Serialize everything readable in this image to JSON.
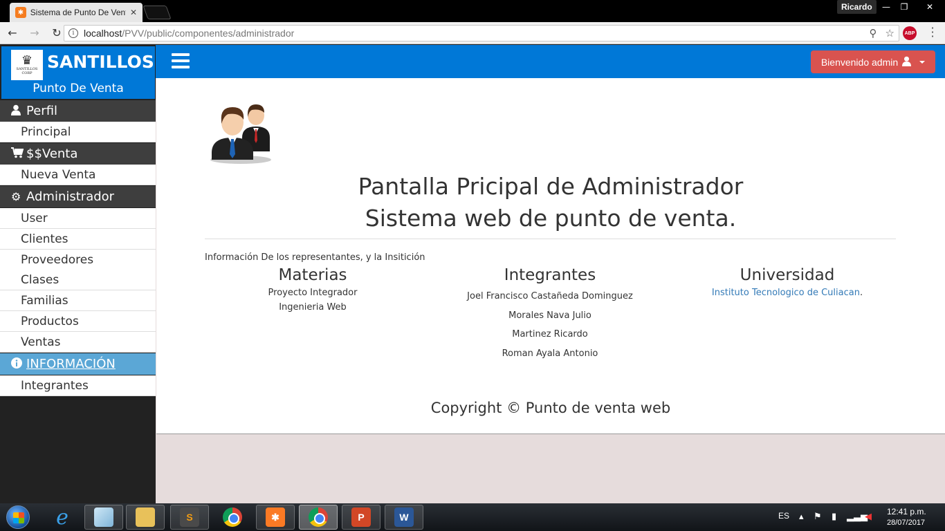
{
  "browser": {
    "tab_title": "Sistema de Punto De Venta",
    "tab_close": "✕",
    "user_badge": "Ricardo",
    "url_host": "localhost",
    "url_path": "/PVV/public/componentes/administrador",
    "abp_label": "ABP"
  },
  "sidebar": {
    "brand_title": "SANTILLOS",
    "brand_subtitle": "Punto De Venta",
    "logo_text": "SANTILLOS",
    "logo_subtext": "CORP",
    "sections": [
      {
        "icon": "user-icon",
        "label": "Perfil",
        "items": [
          "Principal"
        ]
      },
      {
        "icon": "cart-icon",
        "label": "$$Venta",
        "items": [
          "Nueva Venta"
        ]
      },
      {
        "icon": "cogs-icon",
        "label": "Administrador",
        "items": [
          "User",
          "Clientes",
          "Proveedores",
          "Clases",
          "Familias",
          "Productos",
          "Ventas"
        ]
      },
      {
        "icon": "info-icon",
        "label": "INFORMACIÓN",
        "items": [
          "Integrantes"
        ]
      }
    ]
  },
  "topbar": {
    "user_button": "Bienvenido admin"
  },
  "main": {
    "title_line1": "Pantalla Pricipal de Administrador",
    "title_line2": "Sistema web de punto de venta.",
    "info_line": "Información De los representantes, y la Insitición",
    "materias": {
      "heading": "Materias",
      "items": [
        "Proyecto Integrador",
        "Ingenieria Web"
      ]
    },
    "integrantes": {
      "heading": "Integrantes",
      "items": [
        "Joel Francisco Castañeda Dominguez",
        "Morales Nava Julio",
        "Martinez Ricardo",
        "Roman Ayala Antonio"
      ]
    },
    "universidad": {
      "heading": "Universidad",
      "link": "Instituto Tecnologico de Culiacan",
      "suffix": "."
    },
    "copyright": "Copyright © Punto de venta web"
  },
  "taskbar": {
    "language": "ES",
    "time": "12:41 p.m.",
    "date": "28/07/2017"
  },
  "colors": {
    "brand_blue": "#0078d7",
    "danger_red": "#d9534f",
    "info_blue": "#5ba7d6",
    "sidebar_head": "#3e3e3e"
  }
}
